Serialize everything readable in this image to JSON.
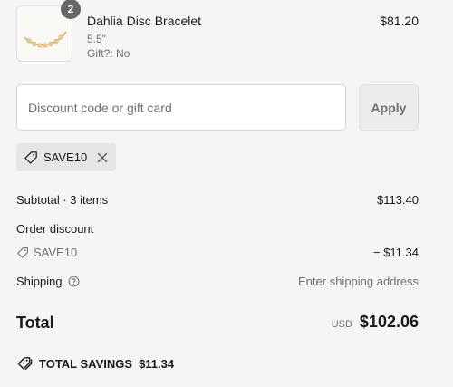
{
  "product": {
    "name": "Dahlia Disc Bracelet",
    "variant": "5.5\"",
    "gift": "Gift?: No",
    "price": "$81.20",
    "quantity": "2"
  },
  "discount": {
    "placeholder": "Discount code or gift card",
    "apply_label": "Apply",
    "applied_code": "SAVE10"
  },
  "summary": {
    "subtotal_label": "Subtotal · 3 items",
    "subtotal_value": "$113.40",
    "order_discount_label": "Order discount",
    "discount_code": "SAVE10",
    "discount_value": "− $11.34",
    "shipping_label": "Shipping",
    "shipping_value": "Enter shipping address",
    "total_label": "Total",
    "currency": "USD",
    "total_value": "$102.06",
    "savings_label": "TOTAL SAVINGS",
    "savings_value": "$11.34"
  },
  "icons": {
    "tag": "tag-icon",
    "remove": "close-icon",
    "info": "help-circle-icon",
    "savings": "tags-icon"
  },
  "colors": {
    "background": "#f5f5f5",
    "badge": "#666666",
    "chip": "#e6e6e6",
    "muted_text": "#707070"
  }
}
